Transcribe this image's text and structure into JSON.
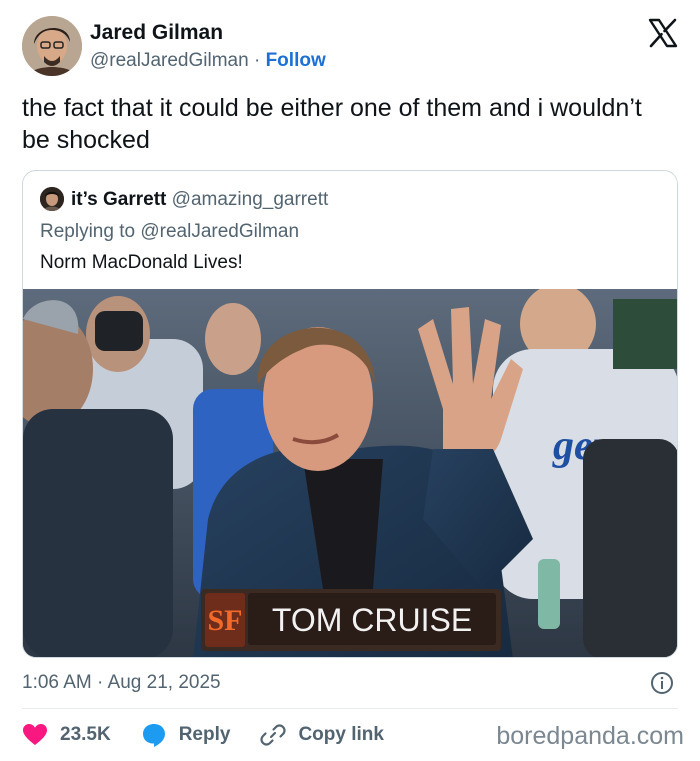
{
  "author": {
    "name": "Jared Gilman",
    "handle": "@realJaredGilman",
    "separator": "·",
    "follow_label": "Follow",
    "avatar_icon": "avatar-photo"
  },
  "brand_icon": "x-logo-icon",
  "tweet": {
    "text": "the fact that it could be either one of them and i wouldn’t be shocked"
  },
  "quoted": {
    "name": "it’s Garrett",
    "handle": "@amazing_garrett",
    "replying_prefix": "Replying to",
    "replying_to": "@realJaredGilman",
    "text": "Norm MacDonald Lives!",
    "photo": {
      "caption_logo": "SF",
      "caption_name": "TOM CRUISE",
      "shirt_text": "gers"
    }
  },
  "timestamp": "1:06 AM · Aug 21, 2025",
  "actions": {
    "likes": "23.5K",
    "reply_label": "Reply",
    "copy_link_label": "Copy link"
  },
  "watermark": "boredpanda.com",
  "colors": {
    "follow": "#1d70d6",
    "like": "#f91880",
    "reply": "#1d9bf0",
    "text_secondary": "#536471"
  }
}
